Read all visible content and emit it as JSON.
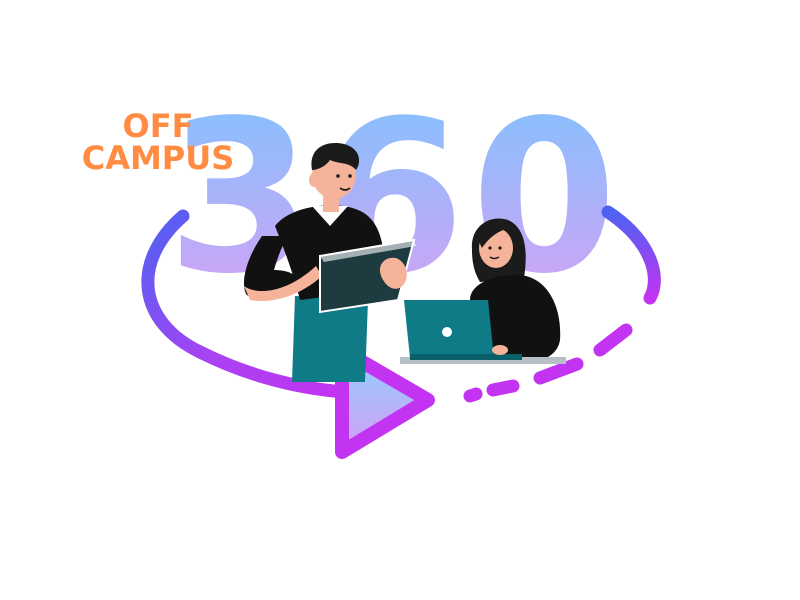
{
  "logo": {
    "line1": "OFF",
    "line2": "CAMPUS",
    "number": "360"
  },
  "colors": {
    "text_orange": "#ff8c42",
    "number_top": "#7cc4ff",
    "number_bottom": "#d69cf5",
    "ring_blue": "#4e62f2",
    "ring_purple": "#c333f2",
    "teal": "#0e7b87",
    "skin": "#f5b49a",
    "hair": "#1b1b1b",
    "shirt": "#111111"
  },
  "icons": [
    "play-triangle-icon",
    "rotation-ring-icon",
    "laptop-icon",
    "tablet-icon"
  ]
}
